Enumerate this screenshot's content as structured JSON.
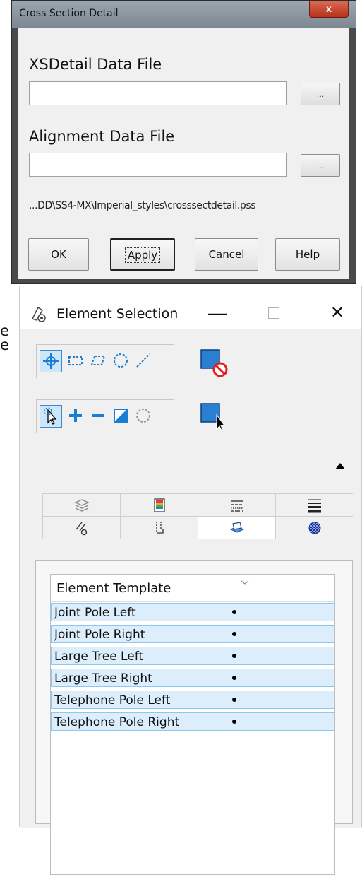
{
  "cross_section_dialog": {
    "title": "Cross Section Detail",
    "close_symbol": "x",
    "xsdetail_label": "XSDetail Data File",
    "xsdetail_value": "",
    "alignment_label": "Alignment Data File",
    "alignment_value": "",
    "browse_label": "...",
    "path_text": "...DD\\SS4-MX\\Imperial_styles\\crosssectdetail.pss",
    "buttons": {
      "ok": "OK",
      "apply": "Apply",
      "cancel": "Cancel",
      "help": "Help"
    }
  },
  "left_fragments": [
    "e",
    "e"
  ],
  "element_selection": {
    "title": "Element Selection",
    "min_symbol": "—",
    "close_symbol": "✕",
    "method_tools": [
      "individual-icon",
      "block-icon",
      "shape-icon",
      "circle-icon",
      "line-icon"
    ],
    "mode_tools": [
      "new-icon",
      "add-icon",
      "subtract-icon",
      "invert-icon",
      "clear-icon"
    ],
    "tabs_row1": [
      "levels-icon",
      "color-icon",
      "line-style-icon",
      "line-weight-icon"
    ],
    "tabs_row2": [
      "element-type-icon",
      "class-icon",
      "element-template-icon",
      "material-icon"
    ],
    "active_tab": "element-template-icon",
    "list": {
      "column_header": "Element Template",
      "rows": [
        "Joint Pole Left",
        "Joint Pole Right",
        "Large Tree Left",
        "Large Tree Right",
        "Telephone Pole Left",
        "Telephone Pole Right"
      ]
    }
  },
  "colors": {
    "selection_blue": "#dcedfb",
    "selection_border": "#8cc8f0",
    "accent": "#1a7fd4"
  }
}
